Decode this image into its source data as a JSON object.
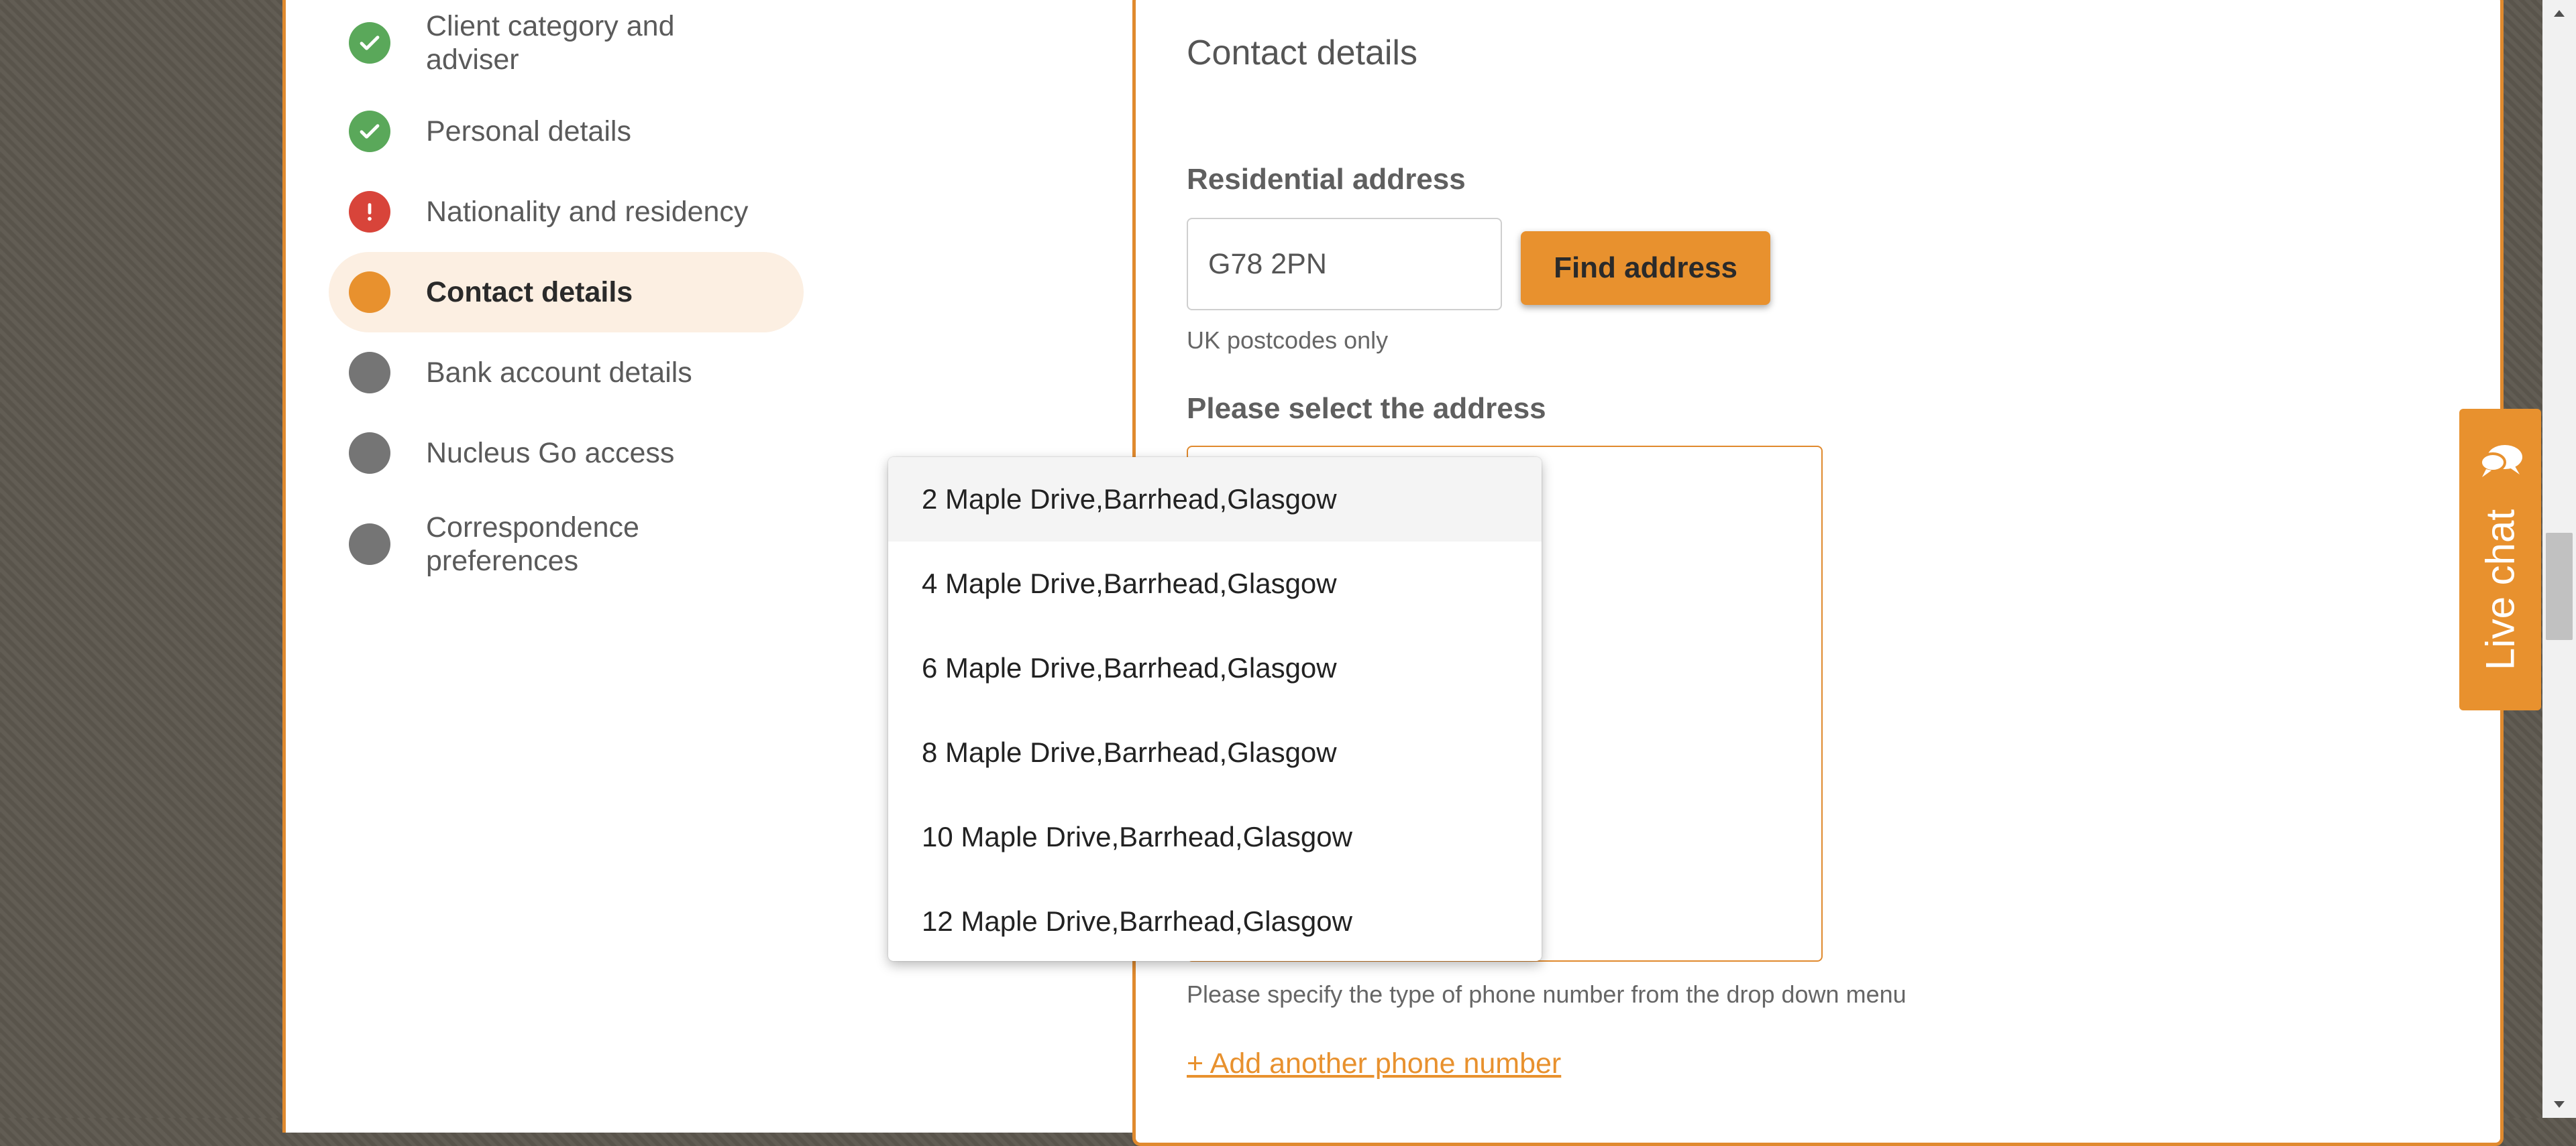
{
  "steps": [
    {
      "label": "Client category and adviser",
      "status": "done"
    },
    {
      "label": "Personal details",
      "status": "done"
    },
    {
      "label": "Nationality and residency",
      "status": "error"
    },
    {
      "label": "Contact details",
      "status": "current"
    },
    {
      "label": "Bank account details",
      "status": "todo"
    },
    {
      "label": "Nucleus Go access",
      "status": "todo"
    },
    {
      "label": "Correspondence preferences",
      "status": "todo"
    }
  ],
  "form": {
    "title": "Contact details",
    "residential_label": "Residential address",
    "postcode_value": "G78 2PN",
    "find_button": "Find address",
    "postcode_hint": "UK postcodes only",
    "select_label": "Please select the address",
    "phone_hint": "Please specify the type of phone number from the drop down menu",
    "add_phone_link": "+ Add another phone number"
  },
  "dropdown": {
    "options": [
      "2 Maple Drive,Barrhead,Glasgow",
      "4 Maple Drive,Barrhead,Glasgow",
      "6 Maple Drive,Barrhead,Glasgow",
      "8 Maple Drive,Barrhead,Glasgow",
      "10 Maple Drive,Barrhead,Glasgow",
      "12 Maple Drive,Barrhead,Glasgow"
    ]
  },
  "live_chat": {
    "label": "Live chat",
    "icon": "chat-bubbles-icon"
  },
  "colors": {
    "accent": "#e8912e",
    "done": "#5aa85a",
    "error": "#d8443a",
    "todo": "#757575"
  }
}
